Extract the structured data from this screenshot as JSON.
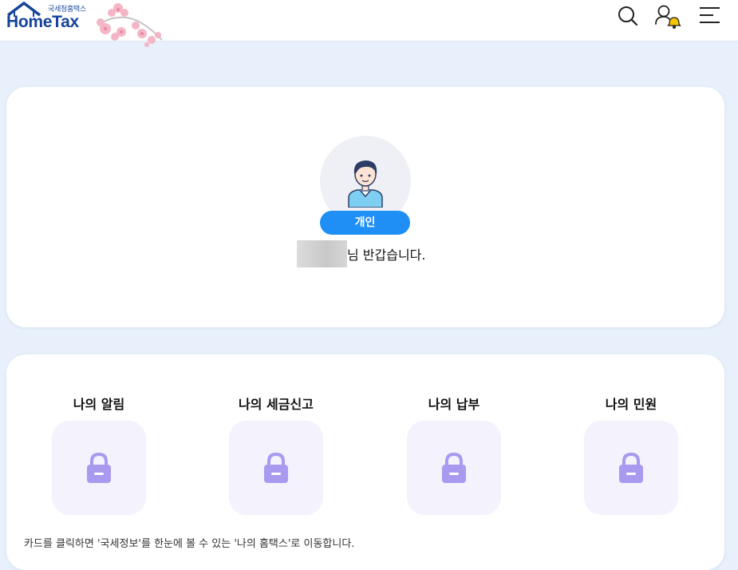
{
  "header": {
    "logo_subtitle": "국세청홈택스",
    "logo_title": "HomeTax",
    "icons": [
      "search-icon",
      "user-notification-icon",
      "menu-icon"
    ],
    "accent_color": "#14439a",
    "bell_color": "#f5c400"
  },
  "profile": {
    "user_type": "개인",
    "greeting_suffix": "님 반갑습니다.",
    "badge_color": "#1f8ff6"
  },
  "services": {
    "items": [
      {
        "title": "나의 알림",
        "icon": "lock-icon"
      },
      {
        "title": "나의 세금신고",
        "icon": "lock-icon"
      },
      {
        "title": "나의 납부",
        "icon": "lock-icon"
      },
      {
        "title": "나의 민원",
        "icon": "lock-icon"
      }
    ],
    "lock_color": "#a99af0",
    "hint": "카드를 클릭하면 '국세정보'를 한눈에 볼 수 있는 '나의 홈택스'로 이동합니다."
  }
}
